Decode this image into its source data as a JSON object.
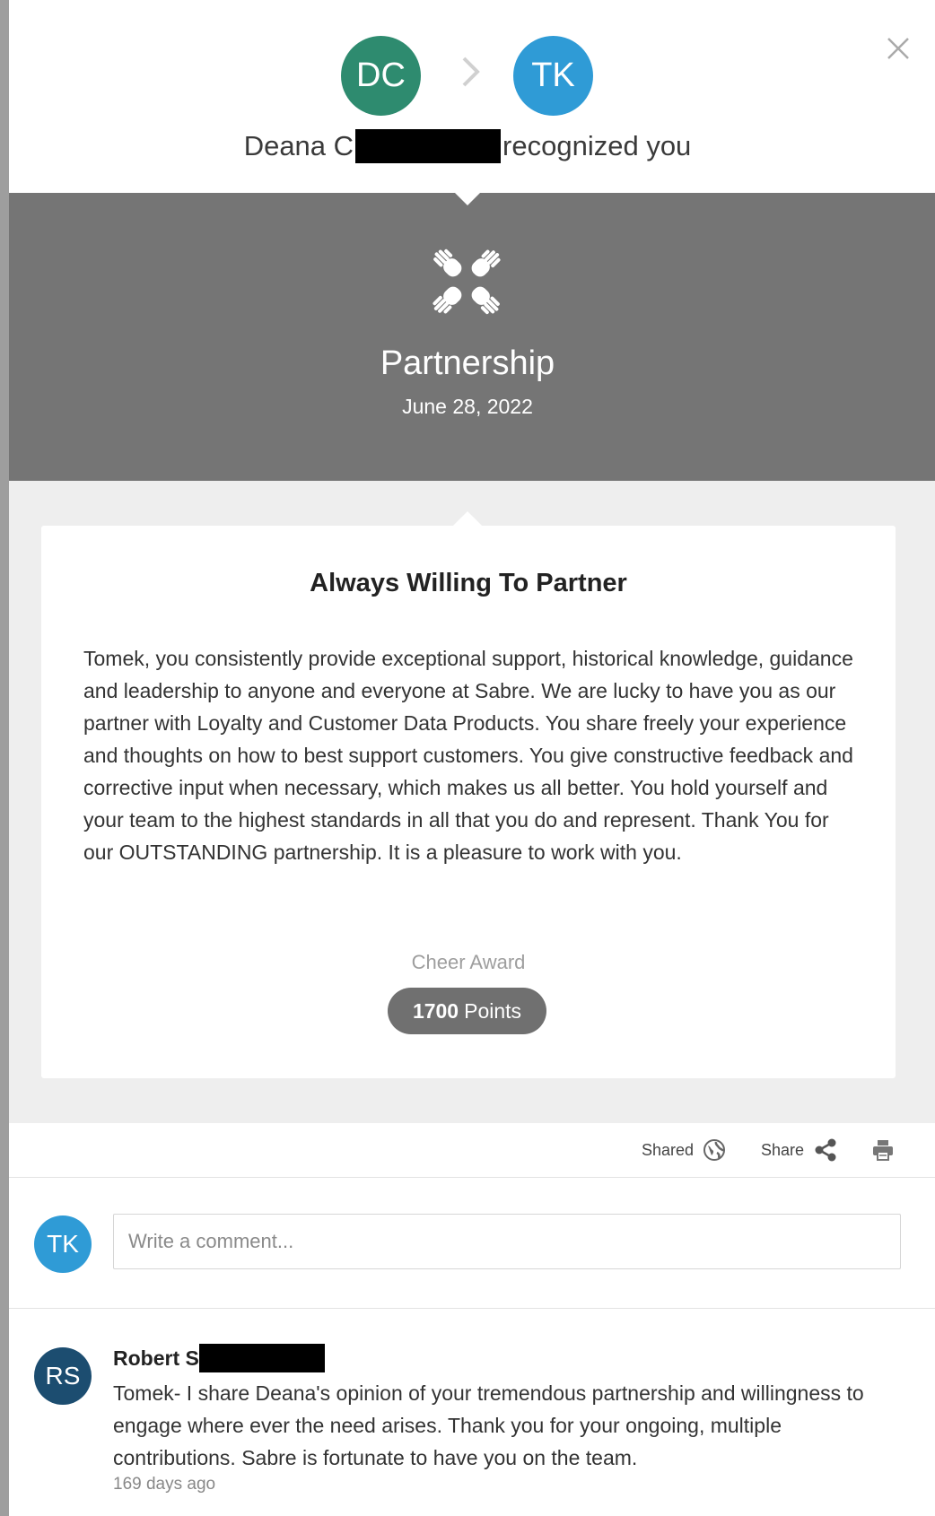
{
  "header": {
    "sender_initials": "DC",
    "recipient_initials": "TK",
    "sender_name_visible": "Deana C",
    "headline_suffix": "recognized you",
    "sender_color": "#2e8b6f",
    "recipient_color": "#2f9bd6",
    "icons": [
      "chevron-right-icon",
      "close-icon"
    ]
  },
  "banner": {
    "value_name": "Partnership",
    "date": "June 28, 2022",
    "background": "#757575",
    "icon": "hands-icon"
  },
  "card": {
    "title": "Always Willing To Partner",
    "message": "Tomek, you consistently provide exceptional support, historical knowledge, guidance and leadership to anyone and everyone at Sabre. We are lucky to have you as our partner with Loyalty and Customer Data Products. You share freely your experience and thoughts on how to best support customers. You give constructive feedback and corrective input when necessary, which makes us all better. You hold yourself and your team to the highest standards in all that you do and represent. Thank You for our OUTSTANDING partnership. It is a pleasure to work with you.",
    "award_type": "Cheer Award",
    "points_value": "1700",
    "points_label": "Points"
  },
  "actions": {
    "shared_label": "Shared",
    "share_label": "Share",
    "icons": [
      "globe-icon",
      "share-icon",
      "print-icon"
    ]
  },
  "comment_box": {
    "user_initials": "TK",
    "placeholder": "Write a comment..."
  },
  "comments": [
    {
      "initials": "RS",
      "avatar_color": "#1c4d70",
      "author_visible": "Robert S",
      "text": "Tomek- I share Deana's opinion of your tremendous partnership and willingness to engage where ever the need arises. Thank you for your ongoing, multiple contributions. Sabre is fortunate to have you on the team.",
      "time": "169 days ago"
    }
  ]
}
